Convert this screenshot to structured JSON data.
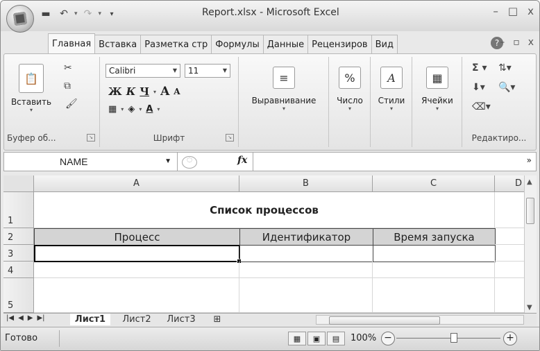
{
  "window": {
    "title": "Report.xlsx - Microsoft Excel",
    "controls": [
      "–",
      "□",
      "x"
    ]
  },
  "quick_access": {
    "save_icon": "floppy-disk-icon",
    "undo_icon": "undo-icon",
    "redo_icon": "redo-icon"
  },
  "ribbon_tabs": [
    {
      "label": "Главная",
      "active": true
    },
    {
      "label": "Вставка"
    },
    {
      "label": "Разметка стр"
    },
    {
      "label": "Формулы"
    },
    {
      "label": "Данные"
    },
    {
      "label": "Рецензиров"
    },
    {
      "label": "Вид"
    }
  ],
  "ribbon": {
    "clipboard": {
      "paste_label": "Вставить",
      "group_label": "Буфер об..."
    },
    "font": {
      "family": "Calibri",
      "size": "11",
      "group_label": "Шрифт",
      "bold": "Ж",
      "italic": "К",
      "underline": "Ч",
      "grow": "A",
      "shrink": "A"
    },
    "alignment": {
      "label": "Выравнивание"
    },
    "number": {
      "label": "Число",
      "glyph": "%"
    },
    "styles": {
      "label": "Стили"
    },
    "cells": {
      "label": "Ячейки"
    },
    "editing": {
      "group_label": "Редактиро..."
    }
  },
  "formula_bar": {
    "name_box": "NAME",
    "fx": "fx",
    "content": ""
  },
  "columns": [
    "A",
    "B",
    "C",
    "D"
  ],
  "rows": [
    "1",
    "2",
    "3",
    "4",
    "5"
  ],
  "cells": {
    "title": "Список процессов",
    "headers": [
      "Процесс",
      "Идентификатор",
      "Время запуска"
    ],
    "row3": [
      "",
      "",
      ""
    ]
  },
  "sheet_tabs": [
    {
      "label": "Лист1",
      "active": true
    },
    {
      "label": "Лист2"
    },
    {
      "label": "Лист3"
    }
  ],
  "status": {
    "text": "Готово",
    "zoom": "100%"
  }
}
